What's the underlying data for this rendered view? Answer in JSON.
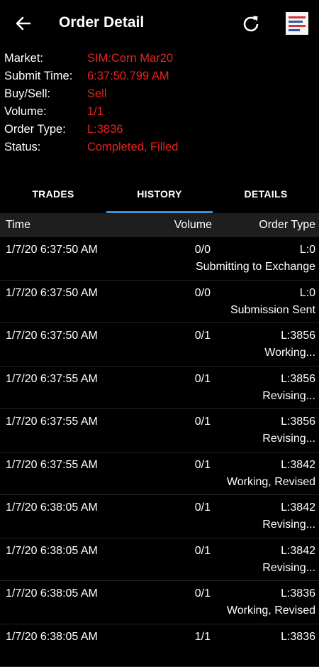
{
  "header": {
    "title": "Order Detail"
  },
  "info": [
    {
      "key": "Market:",
      "value": "SIM:Corn Mar20"
    },
    {
      "key": "Submit Time:",
      "value": "6:37:50.799 AM"
    },
    {
      "key": "Buy/Sell:",
      "value": "Sell"
    },
    {
      "key": "Volume:",
      "value": "1/1"
    },
    {
      "key": "Order Type:",
      "value": "L:3836"
    },
    {
      "key": "Status:",
      "value": "Completed, Filled"
    }
  ],
  "tabs": [
    {
      "label": "TRADES"
    },
    {
      "label": "HISTORY"
    },
    {
      "label": "DETAILS"
    }
  ],
  "columns": {
    "time": "Time",
    "volume": "Volume",
    "order_type": "Order Type"
  },
  "rows": [
    {
      "time": "1/7/20 6:37:50 AM",
      "volume": "0/0",
      "order_type": "L:0",
      "status": "Submitting to Exchange"
    },
    {
      "time": "1/7/20 6:37:50 AM",
      "volume": "0/0",
      "order_type": "L:0",
      "status": "Submission Sent"
    },
    {
      "time": "1/7/20 6:37:50 AM",
      "volume": "0/1",
      "order_type": "L:3856",
      "status": "Working..."
    },
    {
      "time": "1/7/20 6:37:55 AM",
      "volume": "0/1",
      "order_type": "L:3856",
      "status": "Revising..."
    },
    {
      "time": "1/7/20 6:37:55 AM",
      "volume": "0/1",
      "order_type": "L:3856",
      "status": "Revising..."
    },
    {
      "time": "1/7/20 6:37:55 AM",
      "volume": "0/1",
      "order_type": "L:3842",
      "status": "Working, Revised"
    },
    {
      "time": "1/7/20 6:38:05 AM",
      "volume": "0/1",
      "order_type": "L:3842",
      "status": "Revising..."
    },
    {
      "time": "1/7/20 6:38:05 AM",
      "volume": "0/1",
      "order_type": "L:3842",
      "status": "Revising..."
    },
    {
      "time": "1/7/20 6:38:05 AM",
      "volume": "0/1",
      "order_type": "L:3836",
      "status": "Working, Revised"
    },
    {
      "time": "1/7/20 6:38:05 AM",
      "volume": "1/1",
      "order_type": "L:3836",
      "status": ""
    }
  ],
  "icons": {
    "back": "back-arrow-icon",
    "refresh": "refresh-icon",
    "logo": "app-logo-icon"
  },
  "colors": {
    "value": "#e8231f",
    "accent": "#3d8fd6",
    "header_bg": "#1e1e1e"
  }
}
